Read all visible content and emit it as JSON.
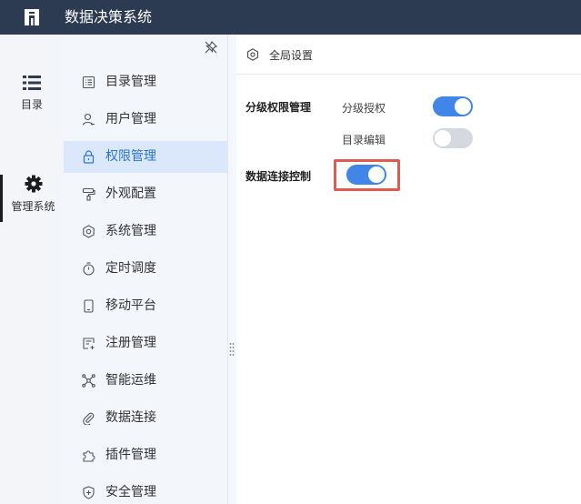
{
  "app": {
    "title": "数据决策系统"
  },
  "left_nav": [
    {
      "label": "目录",
      "icon": "list-icon",
      "active": false
    },
    {
      "label": "管理系统",
      "icon": "gear-icon",
      "active": true
    }
  ],
  "submenu": [
    {
      "label": "目录管理",
      "icon": "catalog-icon"
    },
    {
      "label": "用户管理",
      "icon": "user-icon"
    },
    {
      "label": "权限管理",
      "icon": "lock-icon",
      "active": true
    },
    {
      "label": "外观配置",
      "icon": "paint-roller-icon"
    },
    {
      "label": "系统管理",
      "icon": "settings-icon"
    },
    {
      "label": "定时调度",
      "icon": "timer-icon"
    },
    {
      "label": "移动平台",
      "icon": "mobile-icon"
    },
    {
      "label": "注册管理",
      "icon": "register-icon"
    },
    {
      "label": "智能运维",
      "icon": "network-icon"
    },
    {
      "label": "数据连接",
      "icon": "paperclip-icon"
    },
    {
      "label": "插件管理",
      "icon": "puzzle-icon"
    },
    {
      "label": "安全管理",
      "icon": "shield-icon"
    }
  ],
  "header": {
    "title": "全局设置"
  },
  "settings": {
    "section1": {
      "title": "分级权限管理",
      "options": [
        {
          "label": "分级授权",
          "enabled": true
        },
        {
          "label": "目录编辑",
          "enabled": false
        }
      ]
    },
    "section2": {
      "title": "数据连接控制",
      "enabled": true
    }
  },
  "colors": {
    "topbar": "#2c3a52",
    "accent": "#3f86e8",
    "active_bg": "#dbe8fb",
    "highlight": "#e05a50"
  }
}
